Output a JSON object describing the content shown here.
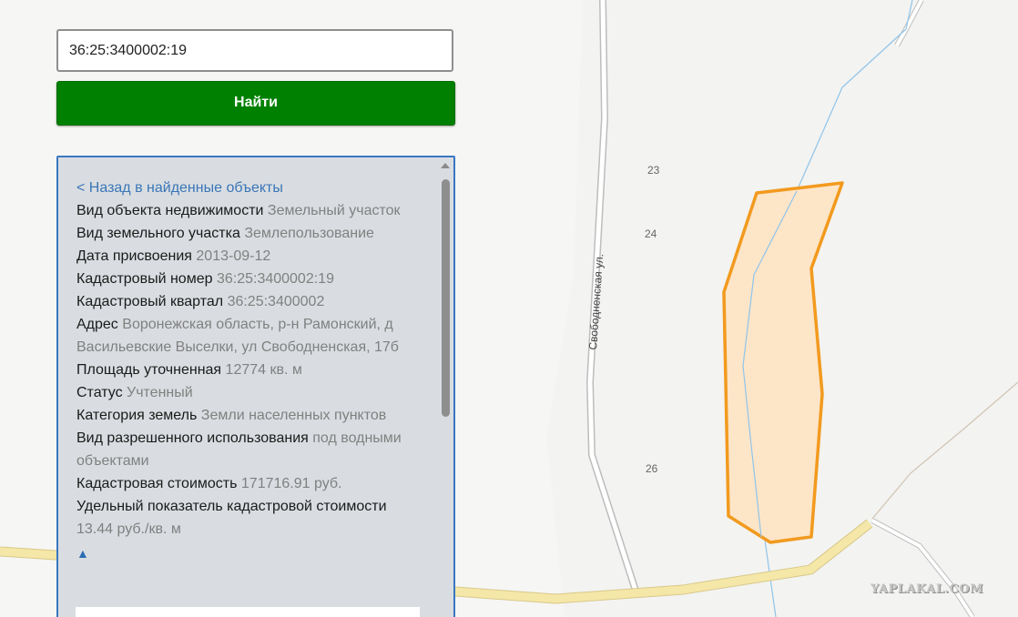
{
  "search": {
    "value": "36:25:3400002:19",
    "button_label": "Найти"
  },
  "panel": {
    "back_link": "< Назад в найденные объекты",
    "fields": [
      {
        "label": "Вид объекта недвижимости",
        "value": "Земельный участок"
      },
      {
        "label": "Вид земельного участка",
        "value": "Землепользование"
      },
      {
        "label": "Дата присвоения",
        "value": "2013-09-12"
      },
      {
        "label": "Кадастровый номер",
        "value": "36:25:3400002:19"
      },
      {
        "label": "Кадастровый квартал",
        "value": "36:25:3400002"
      },
      {
        "label": "Адрес",
        "value": "Воронежская область, р-н Рамонский, д Васильевские Выселки, ул Свободненская, 17б"
      },
      {
        "label": "Площадь уточненная",
        "value": "12774 кв. м"
      },
      {
        "label": "Статус",
        "value": "Учтенный"
      },
      {
        "label": "Категория земель",
        "value": "Земли населенных пунктов"
      },
      {
        "label": "Вид разрешенного использования",
        "value": "под водными объектами"
      },
      {
        "label": "Кадастровая стоимость",
        "value": "171716.91 руб."
      },
      {
        "label": "Удельный показатель кадастровой стоимости",
        "value": "13.44 руб./кв. м"
      }
    ],
    "up_arrow": "▲"
  },
  "map": {
    "street_name": "Свободненская ул.",
    "plot_numbers": [
      "23",
      "24",
      "26"
    ],
    "parcel_fill": "#fde5c8",
    "parcel_stroke": "#f29a1e",
    "road_color": "#f5e7a8",
    "river_color": "#8fc4ea"
  },
  "watermark": "YAPLAKAL.COM"
}
